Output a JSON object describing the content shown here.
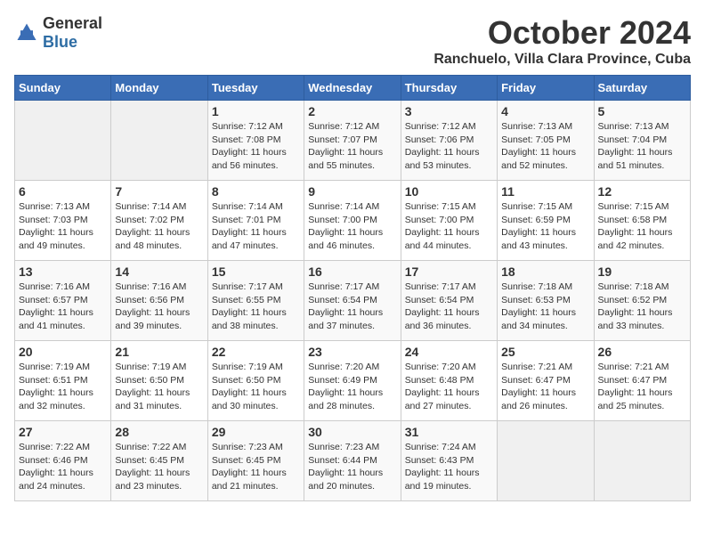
{
  "header": {
    "logo_general": "General",
    "logo_blue": "Blue",
    "month": "October 2024",
    "location": "Ranchuelo, Villa Clara Province, Cuba"
  },
  "days_of_week": [
    "Sunday",
    "Monday",
    "Tuesday",
    "Wednesday",
    "Thursday",
    "Friday",
    "Saturday"
  ],
  "weeks": [
    [
      {
        "day": "",
        "empty": true
      },
      {
        "day": "",
        "empty": true
      },
      {
        "day": "1",
        "sunrise": "Sunrise: 7:12 AM",
        "sunset": "Sunset: 7:08 PM",
        "daylight": "Daylight: 11 hours and 56 minutes."
      },
      {
        "day": "2",
        "sunrise": "Sunrise: 7:12 AM",
        "sunset": "Sunset: 7:07 PM",
        "daylight": "Daylight: 11 hours and 55 minutes."
      },
      {
        "day": "3",
        "sunrise": "Sunrise: 7:12 AM",
        "sunset": "Sunset: 7:06 PM",
        "daylight": "Daylight: 11 hours and 53 minutes."
      },
      {
        "day": "4",
        "sunrise": "Sunrise: 7:13 AM",
        "sunset": "Sunset: 7:05 PM",
        "daylight": "Daylight: 11 hours and 52 minutes."
      },
      {
        "day": "5",
        "sunrise": "Sunrise: 7:13 AM",
        "sunset": "Sunset: 7:04 PM",
        "daylight": "Daylight: 11 hours and 51 minutes."
      }
    ],
    [
      {
        "day": "6",
        "sunrise": "Sunrise: 7:13 AM",
        "sunset": "Sunset: 7:03 PM",
        "daylight": "Daylight: 11 hours and 49 minutes."
      },
      {
        "day": "7",
        "sunrise": "Sunrise: 7:14 AM",
        "sunset": "Sunset: 7:02 PM",
        "daylight": "Daylight: 11 hours and 48 minutes."
      },
      {
        "day": "8",
        "sunrise": "Sunrise: 7:14 AM",
        "sunset": "Sunset: 7:01 PM",
        "daylight": "Daylight: 11 hours and 47 minutes."
      },
      {
        "day": "9",
        "sunrise": "Sunrise: 7:14 AM",
        "sunset": "Sunset: 7:00 PM",
        "daylight": "Daylight: 11 hours and 46 minutes."
      },
      {
        "day": "10",
        "sunrise": "Sunrise: 7:15 AM",
        "sunset": "Sunset: 7:00 PM",
        "daylight": "Daylight: 11 hours and 44 minutes."
      },
      {
        "day": "11",
        "sunrise": "Sunrise: 7:15 AM",
        "sunset": "Sunset: 6:59 PM",
        "daylight": "Daylight: 11 hours and 43 minutes."
      },
      {
        "day": "12",
        "sunrise": "Sunrise: 7:15 AM",
        "sunset": "Sunset: 6:58 PM",
        "daylight": "Daylight: 11 hours and 42 minutes."
      }
    ],
    [
      {
        "day": "13",
        "sunrise": "Sunrise: 7:16 AM",
        "sunset": "Sunset: 6:57 PM",
        "daylight": "Daylight: 11 hours and 41 minutes."
      },
      {
        "day": "14",
        "sunrise": "Sunrise: 7:16 AM",
        "sunset": "Sunset: 6:56 PM",
        "daylight": "Daylight: 11 hours and 39 minutes."
      },
      {
        "day": "15",
        "sunrise": "Sunrise: 7:17 AM",
        "sunset": "Sunset: 6:55 PM",
        "daylight": "Daylight: 11 hours and 38 minutes."
      },
      {
        "day": "16",
        "sunrise": "Sunrise: 7:17 AM",
        "sunset": "Sunset: 6:54 PM",
        "daylight": "Daylight: 11 hours and 37 minutes."
      },
      {
        "day": "17",
        "sunrise": "Sunrise: 7:17 AM",
        "sunset": "Sunset: 6:54 PM",
        "daylight": "Daylight: 11 hours and 36 minutes."
      },
      {
        "day": "18",
        "sunrise": "Sunrise: 7:18 AM",
        "sunset": "Sunset: 6:53 PM",
        "daylight": "Daylight: 11 hours and 34 minutes."
      },
      {
        "day": "19",
        "sunrise": "Sunrise: 7:18 AM",
        "sunset": "Sunset: 6:52 PM",
        "daylight": "Daylight: 11 hours and 33 minutes."
      }
    ],
    [
      {
        "day": "20",
        "sunrise": "Sunrise: 7:19 AM",
        "sunset": "Sunset: 6:51 PM",
        "daylight": "Daylight: 11 hours and 32 minutes."
      },
      {
        "day": "21",
        "sunrise": "Sunrise: 7:19 AM",
        "sunset": "Sunset: 6:50 PM",
        "daylight": "Daylight: 11 hours and 31 minutes."
      },
      {
        "day": "22",
        "sunrise": "Sunrise: 7:19 AM",
        "sunset": "Sunset: 6:50 PM",
        "daylight": "Daylight: 11 hours and 30 minutes."
      },
      {
        "day": "23",
        "sunrise": "Sunrise: 7:20 AM",
        "sunset": "Sunset: 6:49 PM",
        "daylight": "Daylight: 11 hours and 28 minutes."
      },
      {
        "day": "24",
        "sunrise": "Sunrise: 7:20 AM",
        "sunset": "Sunset: 6:48 PM",
        "daylight": "Daylight: 11 hours and 27 minutes."
      },
      {
        "day": "25",
        "sunrise": "Sunrise: 7:21 AM",
        "sunset": "Sunset: 6:47 PM",
        "daylight": "Daylight: 11 hours and 26 minutes."
      },
      {
        "day": "26",
        "sunrise": "Sunrise: 7:21 AM",
        "sunset": "Sunset: 6:47 PM",
        "daylight": "Daylight: 11 hours and 25 minutes."
      }
    ],
    [
      {
        "day": "27",
        "sunrise": "Sunrise: 7:22 AM",
        "sunset": "Sunset: 6:46 PM",
        "daylight": "Daylight: 11 hours and 24 minutes."
      },
      {
        "day": "28",
        "sunrise": "Sunrise: 7:22 AM",
        "sunset": "Sunset: 6:45 PM",
        "daylight": "Daylight: 11 hours and 23 minutes."
      },
      {
        "day": "29",
        "sunrise": "Sunrise: 7:23 AM",
        "sunset": "Sunset: 6:45 PM",
        "daylight": "Daylight: 11 hours and 21 minutes."
      },
      {
        "day": "30",
        "sunrise": "Sunrise: 7:23 AM",
        "sunset": "Sunset: 6:44 PM",
        "daylight": "Daylight: 11 hours and 20 minutes."
      },
      {
        "day": "31",
        "sunrise": "Sunrise: 7:24 AM",
        "sunset": "Sunset: 6:43 PM",
        "daylight": "Daylight: 11 hours and 19 minutes."
      },
      {
        "day": "",
        "empty": true
      },
      {
        "day": "",
        "empty": true
      }
    ]
  ]
}
